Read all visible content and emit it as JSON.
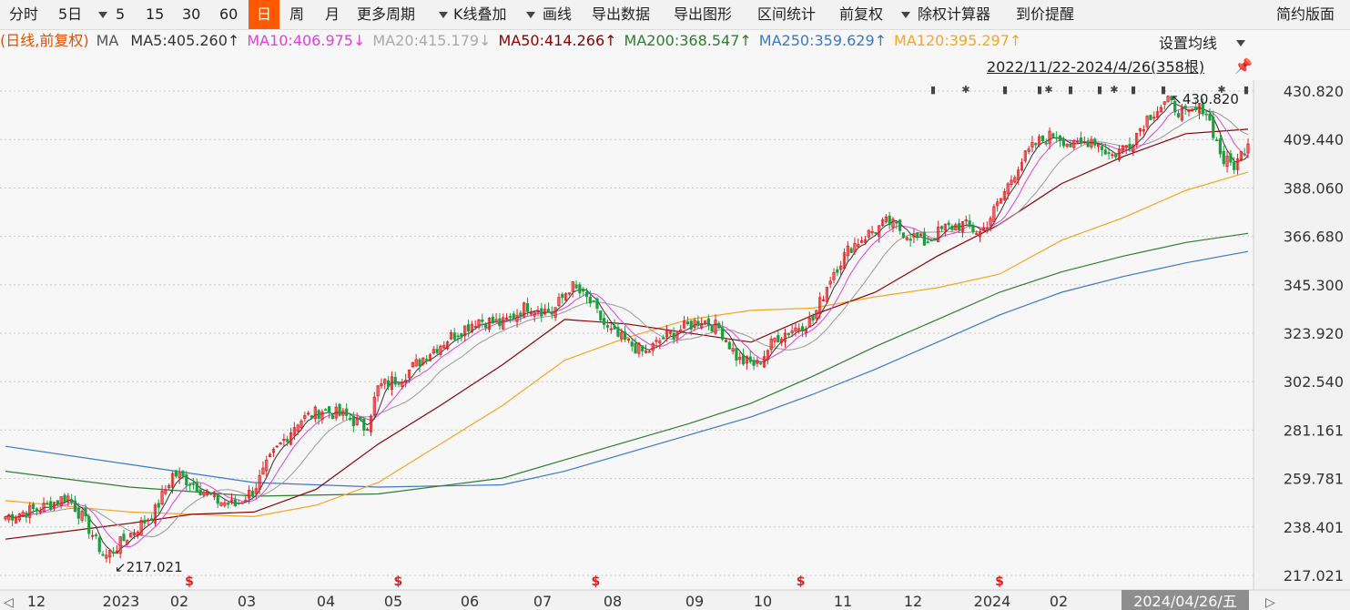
{
  "toolbar": {
    "items": [
      "分时",
      "5日",
      "5",
      "15",
      "30",
      "60",
      "日",
      "周",
      "月",
      "更多周期",
      "K线叠加",
      "画线",
      "导出数据",
      "导出图形",
      "区间统计",
      "前复权",
      "除权计算器",
      "到价提醒"
    ],
    "active": "日",
    "right": "简约版面"
  },
  "ma_legend": {
    "prefix": "(日线,前复权)",
    "ma_label": "MA",
    "items": [
      {
        "text": "MA5:405.260↑",
        "color": "#333333"
      },
      {
        "text": "MA10:406.975↓",
        "color": "#e040e0"
      },
      {
        "text": "MA20:415.179↓",
        "color": "#aaaaaa"
      },
      {
        "text": "MA50:414.266↑",
        "color": "#8b0000"
      },
      {
        "text": "MA200:368.547↑",
        "color": "#2e7d32"
      },
      {
        "text": "MA250:359.629↑",
        "color": "#3a78c9"
      },
      {
        "text": "MA120:395.297↑",
        "color": "#f5a623"
      }
    ]
  },
  "settings_label": "设置均线",
  "range_label": "2022/11/22-2024/4/26(358根)",
  "chart_data": {
    "type": "candlestick",
    "y_ticks": [
      "430.820",
      "409.440",
      "388.060",
      "366.680",
      "345.300",
      "323.920",
      "302.540",
      "281.161",
      "259.781",
      "238.401",
      "217.021"
    ],
    "ylim": [
      217.021,
      430.82
    ],
    "x_labels": [
      "12",
      "2023",
      "02",
      "03",
      "04",
      "05",
      "06",
      "07",
      "08",
      "09",
      "10",
      "11",
      "12",
      "2024",
      "02"
    ],
    "cursor_date": "2024/04/26/五",
    "annotations": [
      {
        "text": "↙217.021",
        "x": 0.085,
        "y": 217.021
      },
      {
        "text": "↖430.820",
        "x": 0.935,
        "y": 430.82
      }
    ],
    "close_series": [
      {
        "x": 0.0,
        "y": 243
      },
      {
        "x": 0.03,
        "y": 247
      },
      {
        "x": 0.05,
        "y": 252
      },
      {
        "x": 0.065,
        "y": 240
      },
      {
        "x": 0.08,
        "y": 225
      },
      {
        "x": 0.1,
        "y": 235
      },
      {
        "x": 0.12,
        "y": 245
      },
      {
        "x": 0.135,
        "y": 262
      },
      {
        "x": 0.15,
        "y": 258
      },
      {
        "x": 0.17,
        "y": 250
      },
      {
        "x": 0.185,
        "y": 248
      },
      {
        "x": 0.2,
        "y": 255
      },
      {
        "x": 0.215,
        "y": 270
      },
      {
        "x": 0.235,
        "y": 285
      },
      {
        "x": 0.255,
        "y": 290
      },
      {
        "x": 0.275,
        "y": 287
      },
      {
        "x": 0.29,
        "y": 282
      },
      {
        "x": 0.3,
        "y": 300
      },
      {
        "x": 0.32,
        "y": 305
      },
      {
        "x": 0.34,
        "y": 315
      },
      {
        "x": 0.36,
        "y": 323
      },
      {
        "x": 0.38,
        "y": 330
      },
      {
        "x": 0.4,
        "y": 328
      },
      {
        "x": 0.42,
        "y": 336
      },
      {
        "x": 0.44,
        "y": 333
      },
      {
        "x": 0.455,
        "y": 345
      },
      {
        "x": 0.47,
        "y": 338
      },
      {
        "x": 0.485,
        "y": 325
      },
      {
        "x": 0.5,
        "y": 320
      },
      {
        "x": 0.515,
        "y": 315
      },
      {
        "x": 0.53,
        "y": 322
      },
      {
        "x": 0.545,
        "y": 326
      },
      {
        "x": 0.56,
        "y": 330
      },
      {
        "x": 0.575,
        "y": 326
      },
      {
        "x": 0.59,
        "y": 312
      },
      {
        "x": 0.605,
        "y": 310
      },
      {
        "x": 0.62,
        "y": 322
      },
      {
        "x": 0.635,
        "y": 326
      },
      {
        "x": 0.65,
        "y": 330
      },
      {
        "x": 0.665,
        "y": 350
      },
      {
        "x": 0.68,
        "y": 362
      },
      {
        "x": 0.695,
        "y": 368
      },
      {
        "x": 0.71,
        "y": 373
      },
      {
        "x": 0.725,
        "y": 368
      },
      {
        "x": 0.74,
        "y": 364
      },
      {
        "x": 0.755,
        "y": 370
      },
      {
        "x": 0.77,
        "y": 372
      },
      {
        "x": 0.785,
        "y": 368
      },
      {
        "x": 0.8,
        "y": 382
      },
      {
        "x": 0.815,
        "y": 398
      },
      {
        "x": 0.83,
        "y": 408
      },
      {
        "x": 0.845,
        "y": 412
      },
      {
        "x": 0.86,
        "y": 406
      },
      {
        "x": 0.875,
        "y": 410
      },
      {
        "x": 0.89,
        "y": 402
      },
      {
        "x": 0.905,
        "y": 408
      },
      {
        "x": 0.92,
        "y": 420
      },
      {
        "x": 0.935,
        "y": 426
      },
      {
        "x": 0.95,
        "y": 420
      },
      {
        "x": 0.965,
        "y": 424
      },
      {
        "x": 0.98,
        "y": 400
      },
      {
        "x": 0.99,
        "y": 398
      },
      {
        "x": 1.0,
        "y": 409
      }
    ],
    "ma120": [
      {
        "x": 0.0,
        "y": 250
      },
      {
        "x": 0.1,
        "y": 245
      },
      {
        "x": 0.2,
        "y": 243
      },
      {
        "x": 0.25,
        "y": 248
      },
      {
        "x": 0.3,
        "y": 258
      },
      {
        "x": 0.35,
        "y": 275
      },
      {
        "x": 0.4,
        "y": 292
      },
      {
        "x": 0.45,
        "y": 312
      },
      {
        "x": 0.5,
        "y": 322
      },
      {
        "x": 0.55,
        "y": 330
      },
      {
        "x": 0.6,
        "y": 334
      },
      {
        "x": 0.65,
        "y": 335
      },
      {
        "x": 0.7,
        "y": 340
      },
      {
        "x": 0.75,
        "y": 344
      },
      {
        "x": 0.8,
        "y": 350
      },
      {
        "x": 0.85,
        "y": 365
      },
      {
        "x": 0.9,
        "y": 375
      },
      {
        "x": 0.95,
        "y": 387
      },
      {
        "x": 1.0,
        "y": 395
      }
    ],
    "ma200": [
      {
        "x": 0.0,
        "y": 263
      },
      {
        "x": 0.1,
        "y": 256
      },
      {
        "x": 0.2,
        "y": 252
      },
      {
        "x": 0.3,
        "y": 253
      },
      {
        "x": 0.4,
        "y": 260
      },
      {
        "x": 0.45,
        "y": 268
      },
      {
        "x": 0.5,
        "y": 276
      },
      {
        "x": 0.55,
        "y": 284
      },
      {
        "x": 0.6,
        "y": 293
      },
      {
        "x": 0.65,
        "y": 305
      },
      {
        "x": 0.7,
        "y": 318
      },
      {
        "x": 0.75,
        "y": 330
      },
      {
        "x": 0.8,
        "y": 342
      },
      {
        "x": 0.85,
        "y": 351
      },
      {
        "x": 0.9,
        "y": 358
      },
      {
        "x": 0.95,
        "y": 364
      },
      {
        "x": 1.0,
        "y": 368
      }
    ],
    "ma250": [
      {
        "x": 0.0,
        "y": 274
      },
      {
        "x": 0.1,
        "y": 266
      },
      {
        "x": 0.2,
        "y": 258
      },
      {
        "x": 0.3,
        "y": 256
      },
      {
        "x": 0.4,
        "y": 257
      },
      {
        "x": 0.45,
        "y": 263
      },
      {
        "x": 0.5,
        "y": 271
      },
      {
        "x": 0.55,
        "y": 279
      },
      {
        "x": 0.6,
        "y": 287
      },
      {
        "x": 0.65,
        "y": 297
      },
      {
        "x": 0.7,
        "y": 308
      },
      {
        "x": 0.75,
        "y": 320
      },
      {
        "x": 0.8,
        "y": 332
      },
      {
        "x": 0.85,
        "y": 342
      },
      {
        "x": 0.9,
        "y": 349
      },
      {
        "x": 0.95,
        "y": 355
      },
      {
        "x": 1.0,
        "y": 360
      }
    ],
    "ma50": [
      {
        "x": 0.0,
        "y": 233
      },
      {
        "x": 0.1,
        "y": 240
      },
      {
        "x": 0.15,
        "y": 244
      },
      {
        "x": 0.2,
        "y": 245
      },
      {
        "x": 0.25,
        "y": 255
      },
      {
        "x": 0.3,
        "y": 275
      },
      {
        "x": 0.35,
        "y": 292
      },
      {
        "x": 0.4,
        "y": 310
      },
      {
        "x": 0.45,
        "y": 330
      },
      {
        "x": 0.5,
        "y": 328
      },
      {
        "x": 0.55,
        "y": 324
      },
      {
        "x": 0.6,
        "y": 320
      },
      {
        "x": 0.65,
        "y": 332
      },
      {
        "x": 0.7,
        "y": 342
      },
      {
        "x": 0.75,
        "y": 358
      },
      {
        "x": 0.8,
        "y": 372
      },
      {
        "x": 0.85,
        "y": 390
      },
      {
        "x": 0.9,
        "y": 402
      },
      {
        "x": 0.95,
        "y": 412
      },
      {
        "x": 1.0,
        "y": 414
      }
    ],
    "colors": {
      "up": "#e02020",
      "down": "#1b9e3e",
      "ma120": "#f5a623",
      "ma200": "#2e7d32",
      "ma250": "#3a78c9",
      "ma50": "#8b0000",
      "ma10": "#e040e0",
      "ma20": "#999999",
      "ma5": "#333333"
    },
    "marker_dates": [
      0.148,
      0.316,
      0.475,
      0.64,
      0.8
    ]
  }
}
